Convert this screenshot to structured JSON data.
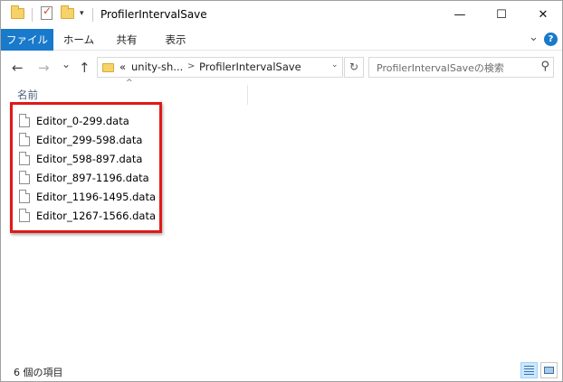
{
  "window": {
    "title": "ProfilerIntervalSave",
    "minimize_glyph": "—",
    "maximize_glyph": "☐",
    "close_glyph": "✕"
  },
  "quick_access": {
    "dropdown_glyph": "▾"
  },
  "ribbon": {
    "tabs": [
      "ファイル",
      "ホーム",
      "共有",
      "表示"
    ],
    "expand_glyph": "⌄",
    "help_glyph": "?"
  },
  "nav": {
    "back_glyph": "←",
    "forward_glyph": "→",
    "recent_glyph": "⌄",
    "up_glyph": "↑"
  },
  "address": {
    "overflow": "«",
    "parts": [
      "unity-sh...",
      "ProfilerIntervalSave"
    ],
    "separator": ">",
    "dropdown_glyph": "⌄",
    "refresh_glyph": "↻"
  },
  "search": {
    "placeholder": "ProfilerIntervalSaveの検索",
    "icon_glyph": "⚲"
  },
  "columns": {
    "name_header": "名前",
    "sort_glyph": "^"
  },
  "files": [
    "Editor_0-299.data",
    "Editor_299-598.data",
    "Editor_598-897.data",
    "Editor_897-1196.data",
    "Editor_1196-1495.data",
    "Editor_1267-1566.data"
  ],
  "status": {
    "item_count": "6 個の項目"
  },
  "colors": {
    "accent": "#1979ca",
    "highlight": "#e01818"
  }
}
